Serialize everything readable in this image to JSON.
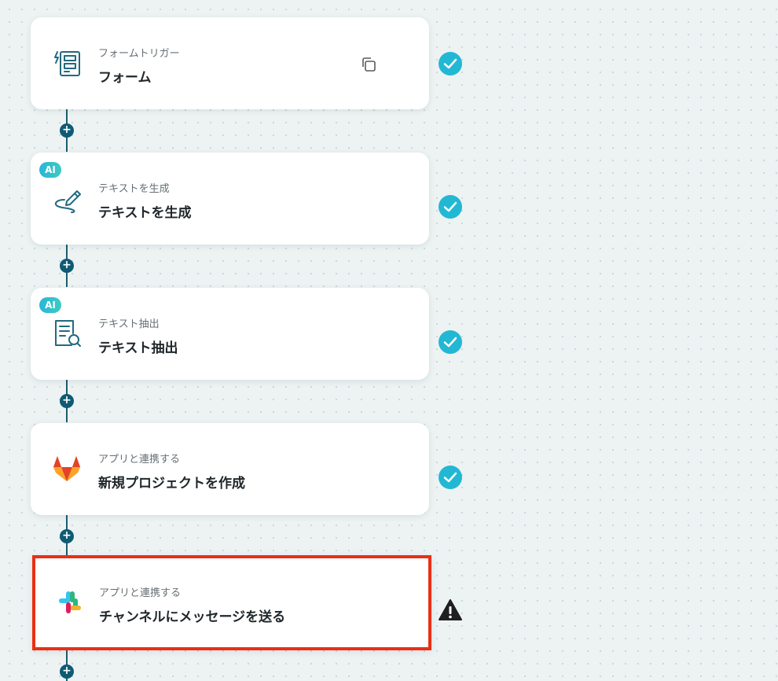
{
  "nodes": [
    {
      "subtitle": "フォームトリガー",
      "title": "フォーム",
      "icon": "form-icon",
      "ai_badge": null,
      "status": "complete"
    },
    {
      "subtitle": "テキストを生成",
      "title": "テキストを生成",
      "icon": "pen-icon",
      "ai_badge": "AI",
      "status": "complete"
    },
    {
      "subtitle": "テキスト抽出",
      "title": "テキスト抽出",
      "icon": "document-search-icon",
      "ai_badge": "AI",
      "status": "complete"
    },
    {
      "subtitle": "アプリと連携する",
      "title": "新規プロジェクトを作成",
      "icon": "gitlab-icon",
      "ai_badge": null,
      "status": "complete"
    },
    {
      "subtitle": "アプリと連携する",
      "title": "チャンネルにメッセージを送る",
      "icon": "slack-icon",
      "ai_badge": null,
      "status": "warning"
    }
  ],
  "add_step_label": "+",
  "colors": {
    "background": "#edf3f3",
    "connector": "#1d5c6e",
    "add_button": "#0f5b73",
    "check": "#22b8d4",
    "warning": "#1f1f1f",
    "selected_border": "#ea2f14",
    "ai_badge": "#29b6d8"
  }
}
